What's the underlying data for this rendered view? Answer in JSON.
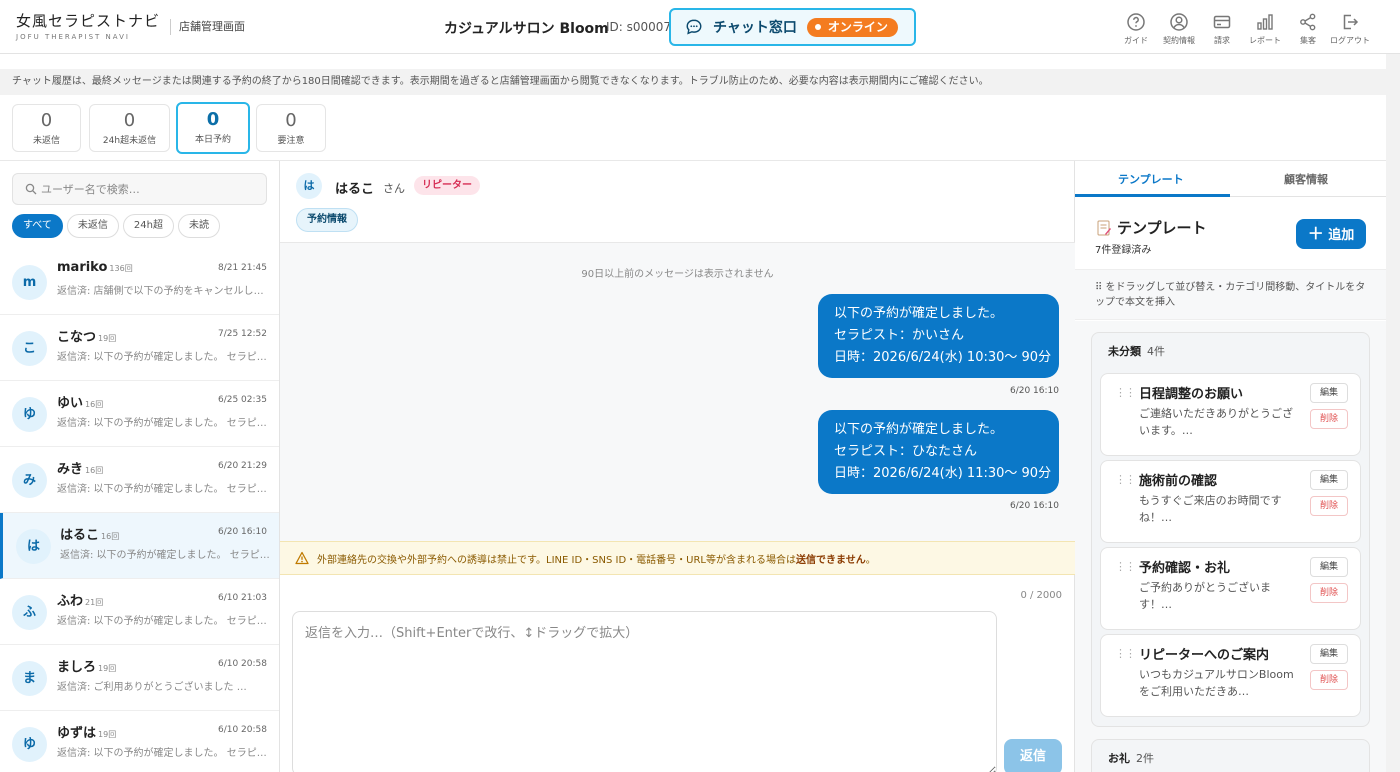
{
  "header": {
    "logo_main": "女風セラピストナビ",
    "logo_sub": "JOFU THERAPIST NAVI",
    "admin_label": "店舗管理画面",
    "salon_name": "カジュアルサロン Bloom",
    "salon_id": "ID: s00007",
    "chat_label": "チャット窓口",
    "online_label": "オンライン",
    "nav": [
      {
        "label": "ガイド",
        "icon": "help-circle-icon"
      },
      {
        "label": "契約情報",
        "icon": "user-icon"
      },
      {
        "label": "請求",
        "icon": "card-icon"
      },
      {
        "label": "レポート",
        "icon": "bar-chart-icon"
      },
      {
        "label": "集客",
        "icon": "share-icon"
      },
      {
        "label": "ログアウト",
        "icon": "logout-icon"
      }
    ]
  },
  "notice": "チャット履歴は、最終メッセージまたは関連する予約の終了から180日間確認できます。表示期間を過ぎると店舗管理画面から閲覧できなくなります。トラブル防止のため、必要な内容は表示期間内にご確認ください。",
  "stats": [
    {
      "value": "0",
      "label": "未返信"
    },
    {
      "value": "0",
      "label": "24h超未返信"
    },
    {
      "value": "0",
      "label": "本日予約"
    },
    {
      "value": "0",
      "label": "要注意"
    }
  ],
  "sidebar": {
    "search_placeholder": "ユーザー名で検索…",
    "filters": [
      "すべて",
      "未返信",
      "24h超",
      "未読"
    ],
    "threads": [
      {
        "avatar": "m",
        "name": "mariko",
        "count": "136回",
        "time": "8/21 21:45",
        "preview": "返信済: 店舗側で以下の予約をキャンセルしました。"
      },
      {
        "avatar": "こ",
        "name": "こなつ",
        "count": "19回",
        "time": "7/25 12:52",
        "preview": "返信済: 以下の予約が確定しました。 セラピスト"
      },
      {
        "avatar": "ゆ",
        "name": "ゆい",
        "count": "16回",
        "time": "6/25 02:35",
        "preview": "返信済: 以下の予約が確定しました。 セラピスト"
      },
      {
        "avatar": "み",
        "name": "みき",
        "count": "16回",
        "time": "6/20 21:29",
        "preview": "返信済: 以下の予約が確定しました。 セラピスト"
      },
      {
        "avatar": "は",
        "name": "はるこ",
        "count": "16回",
        "time": "6/20 16:10",
        "preview": "返信済: 以下の予約が確定しました。 セラピスト"
      },
      {
        "avatar": "ふ",
        "name": "ふわ",
        "count": "21回",
        "time": "6/10 21:03",
        "preview": "返信済: 以下の予約が確定しました。 セラピスト"
      },
      {
        "avatar": "ま",
        "name": "ましろ",
        "count": "19回",
        "time": "6/10 20:58",
        "preview": "返信済: ご利用ありがとうございました …"
      },
      {
        "avatar": "ゆ",
        "name": "ゆずは",
        "count": "19回",
        "time": "6/10 20:58",
        "preview": "返信済: 以下の予約が確定しました。 セラピスト"
      }
    ]
  },
  "chat": {
    "avatar": "は",
    "name": "はるこ",
    "honorific": "さん",
    "badge": "リピーター",
    "reservation_button": "予約情報",
    "older_notice": "90日以上前のメッセージは表示されません",
    "messages": [
      {
        "lines": [
          "以下の予約が確定しました。",
          "セラピスト：かいさん",
          "日時：2026/6/24(水) 10:30〜 90分"
        ],
        "time": "6/20 16:10"
      },
      {
        "lines": [
          "以下の予約が確定しました。",
          "セラピスト：ひなたさん",
          "日時：2026/6/24(水) 11:30〜 90分"
        ],
        "time": "6/20 16:10"
      }
    ],
    "warning_text": "外部連絡先の交換や外部予約への誘導は禁止です。LINE ID・SNS ID・電話番号・URL等が含まれる場合は",
    "warning_bold": "送信できません",
    "warning_end": "。",
    "char_counter": "0 / 2000",
    "reply_placeholder": "返信を入力…（Shift+Enterで改行、↕ドラッグで拡大）",
    "send_label": "返信"
  },
  "right_panel": {
    "tabs": [
      "テンプレート",
      "顧客情報"
    ],
    "title": "テンプレート",
    "count": "7件登録済み",
    "add_label": "追加",
    "help": "⠿ をドラッグして並び替え・カテゴリ間移動、タイトルをタップで本文を挿入",
    "edit_label": "編集",
    "delete_label": "削除",
    "groups": [
      {
        "name": "未分類",
        "count": "4件",
        "templates": [
          {
            "title": "日程調整のお願い",
            "body": "ご連絡いただきありがとうございます。…"
          },
          {
            "title": "施術前の確認",
            "body": "もうすぐご来店のお時間ですね！…"
          },
          {
            "title": "予約確認・お礼",
            "body": "ご予約ありがとうございます！…"
          },
          {
            "title": "リピーターへのご案内",
            "body": "いつもカジュアルサロンBloomをご利用いただきあ…"
          }
        ]
      },
      {
        "name": "お礼",
        "count": "2件",
        "templates": []
      }
    ]
  },
  "colors": {
    "accent": "#0b78c8",
    "highlight_border": "#29b6e8",
    "online": "#f47c20",
    "repeater_badge": "#d62d54"
  }
}
